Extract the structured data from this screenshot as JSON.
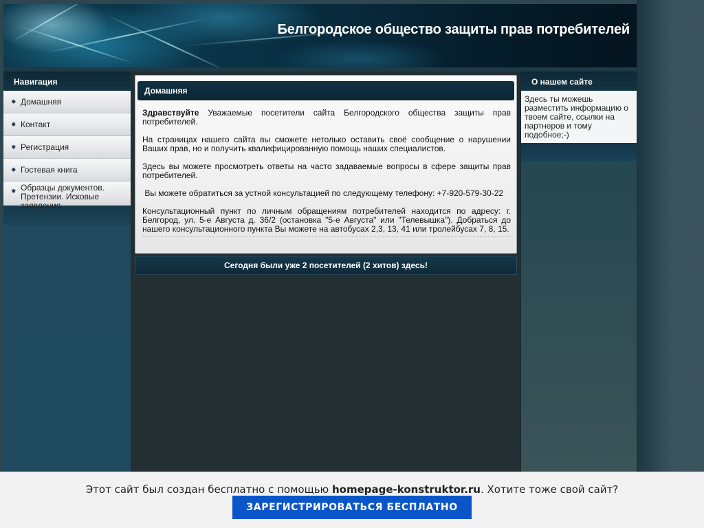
{
  "header": {
    "title": "Белгородское общество защиты прав потребителей"
  },
  "sidebar": {
    "heading": "Навигация",
    "items": [
      {
        "label": "Домашняя"
      },
      {
        "label": "Контакт"
      },
      {
        "label": "Регистрация"
      },
      {
        "label": "Гостевая книга"
      },
      {
        "label": "Образцы документов. Претензии. Исковые заявления"
      }
    ]
  },
  "main": {
    "heading": "Домашняя",
    "greeting_bold": "Здравствуйте",
    "greeting_rest": " Уважаемые посетители сайта Белгородского общества  защиты прав потребителей.",
    "paragraphs": [
      "На страницах нашего сайта вы сможете нетолько оставить своё сообщение о нарушении Ваших прав, но и получить квалифицированную помощь наших специалистов.",
      "Здесь вы можете просмотреть ответы на часто задаваемые вопросы в сфере  защиты прав потребителей.",
      " Вы можете обратиться за устной консультацией по следующему телефону: +7-920-579-30-22",
      "Консультационный пункт по личным обращениям потребителей находится по адресу: г. Белгород, ул. 5-е Августа д. 36/2 (остановка \"5-е Августа\" или \"Телевышка\"). Добраться до нашего консультационного пункта Вы можете на автобусах 2,3, 13, 41 или тролейбусах 7, 8, 15."
    ],
    "stats": "Сегодня были уже 2 посетителей (2 хитов) здесь!"
  },
  "right": {
    "heading": "О нашем сайте",
    "body": "Здесь ты можешь разместить информацию о твоем сайте, ссылки на партнеров и тому подобное;-)"
  },
  "footer": {
    "text_before": "Этот сайт был создан бесплатно с помощью ",
    "site": "homepage-konstruktor.ru",
    "text_after": ". Хотите тоже свой сайт?",
    "button": "ЗАРЕГИСТРИРОВАТЬСЯ БЕСПЛАТНО"
  },
  "colors": {
    "accent_button": "#0a56c8",
    "panel_header": "#0e2835"
  }
}
